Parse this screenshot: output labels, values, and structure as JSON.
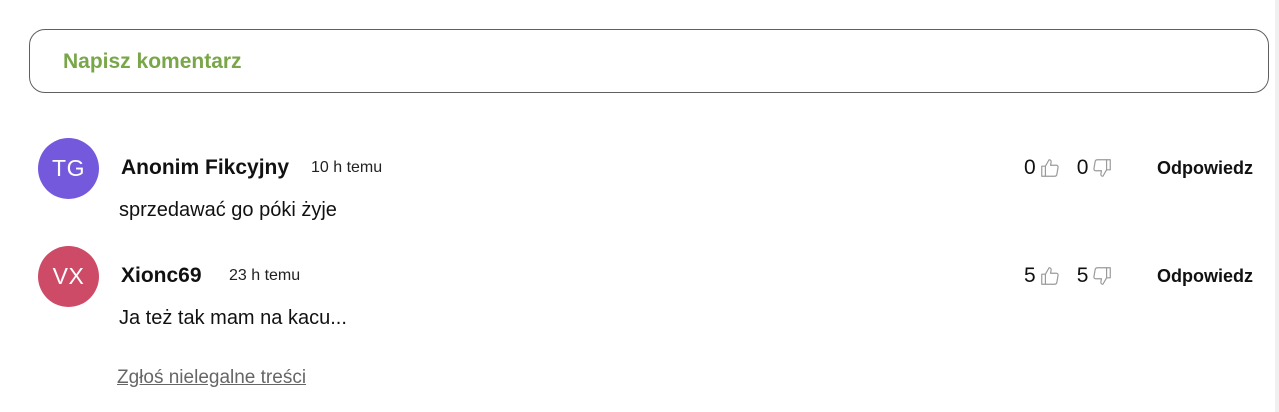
{
  "comment_form": {
    "placeholder": "Napisz komentarz"
  },
  "comments": [
    {
      "initials": "TG",
      "avatar_color": "#7559dd",
      "author": "Anonim Fikcyjny",
      "time": "10 h temu",
      "text": "sprzedawać go póki żyje",
      "likes": "0",
      "dislikes": "0",
      "reply_label": "Odpowiedz"
    },
    {
      "initials": "VX",
      "avatar_color": "#cd4b67",
      "author": "Xionc69",
      "time": "23 h temu",
      "text": "Ja też tak mam na kacu...",
      "likes": "5",
      "dislikes": "5",
      "reply_label": "Odpowiedz"
    }
  ],
  "report_link": "Zgłoś nielegalne treści",
  "icons": {
    "like": "thumbs-up-icon",
    "dislike": "thumbs-down-icon"
  },
  "colors": {
    "accent_green": "#7aa64a"
  }
}
